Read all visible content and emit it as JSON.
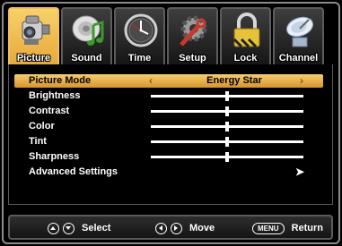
{
  "tabs": [
    {
      "label": "Picture",
      "icon": "camcorder-icon",
      "active": true
    },
    {
      "label": "Sound",
      "icon": "speaker-note-icon",
      "active": false
    },
    {
      "label": "Time",
      "icon": "clock-icon",
      "active": false
    },
    {
      "label": "Setup",
      "icon": "gear-wrench-icon",
      "active": false
    },
    {
      "label": "Lock",
      "icon": "padlock-icon",
      "active": false
    },
    {
      "label": "Channel",
      "icon": "satellite-dish-icon",
      "active": false
    }
  ],
  "menu": {
    "picture_mode": {
      "label": "Picture Mode",
      "value": "Energy Star"
    },
    "brightness": {
      "label": "Brightness",
      "level": 0.5
    },
    "contrast": {
      "label": "Contrast",
      "level": 0.5
    },
    "color": {
      "label": "Color",
      "level": 0.5
    },
    "tint": {
      "label": "Tint",
      "level": 0.5
    },
    "sharpness": {
      "label": "Sharpness",
      "level": 0.5
    },
    "advanced": {
      "label": "Advanced Settings"
    }
  },
  "footer": {
    "select": "Select",
    "move": "Move",
    "menu_key": "MENU",
    "return": "Return"
  },
  "colors": {
    "accent": "#f0b850",
    "background": "#000000"
  }
}
